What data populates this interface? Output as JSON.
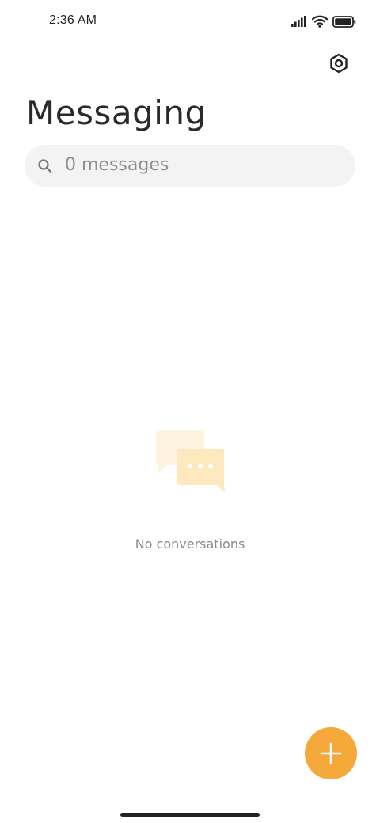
{
  "status_bar": {
    "time": "2:36 AM",
    "icons": [
      "signal-icon",
      "wifi-icon",
      "battery-icon"
    ]
  },
  "header": {
    "title": "Messaging",
    "settings_icon": "settings-icon"
  },
  "search": {
    "placeholder": "0 messages",
    "icon": "search-icon"
  },
  "empty_state": {
    "illustration_icon": "chat-bubbles-icon",
    "message": "No conversations"
  },
  "fab": {
    "icon": "plus-icon"
  },
  "colors": {
    "accent": "#f5a93a",
    "title": "#2a2a2a",
    "search_bg": "#f3f3f3",
    "muted_text": "#8a8a8a",
    "illustration_light": "#fdf2d9",
    "illustration_mid": "#fde9bd"
  }
}
